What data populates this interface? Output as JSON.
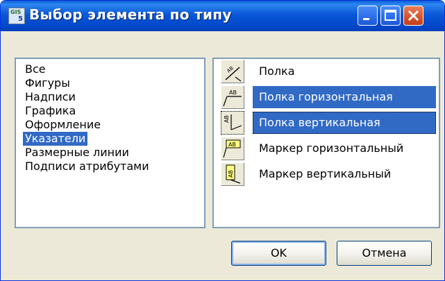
{
  "window": {
    "title": "Выбор элемента по типу",
    "app_icon_text": "GIS 5"
  },
  "categories": {
    "items": [
      "Все",
      "Фигуры",
      "Надписи",
      "Графика",
      "Оформление",
      "Указатели",
      "Размерные линии",
      "Подписи атрибутами"
    ],
    "selected": "Указатели"
  },
  "pointers": {
    "items": [
      {
        "label": "Полка",
        "icon": "leader-shelf-icon",
        "selected": false
      },
      {
        "label": "Полка горизонтальная",
        "icon": "leader-shelf-horizontal-icon",
        "selected": true
      },
      {
        "label": "Полка вертикальная",
        "icon": "leader-shelf-vertical-icon",
        "selected": true
      },
      {
        "label": "Маркер горизонтальный",
        "icon": "marker-horizontal-icon",
        "selected": false
      },
      {
        "label": "Маркер вертикальный",
        "icon": "marker-vertical-icon",
        "selected": false
      }
    ]
  },
  "buttons": {
    "ok": "OK",
    "cancel": "Отмена"
  },
  "colors": {
    "selection": "#316ac5",
    "titlebar": "#0a58d8",
    "face": "#ece9d8"
  }
}
